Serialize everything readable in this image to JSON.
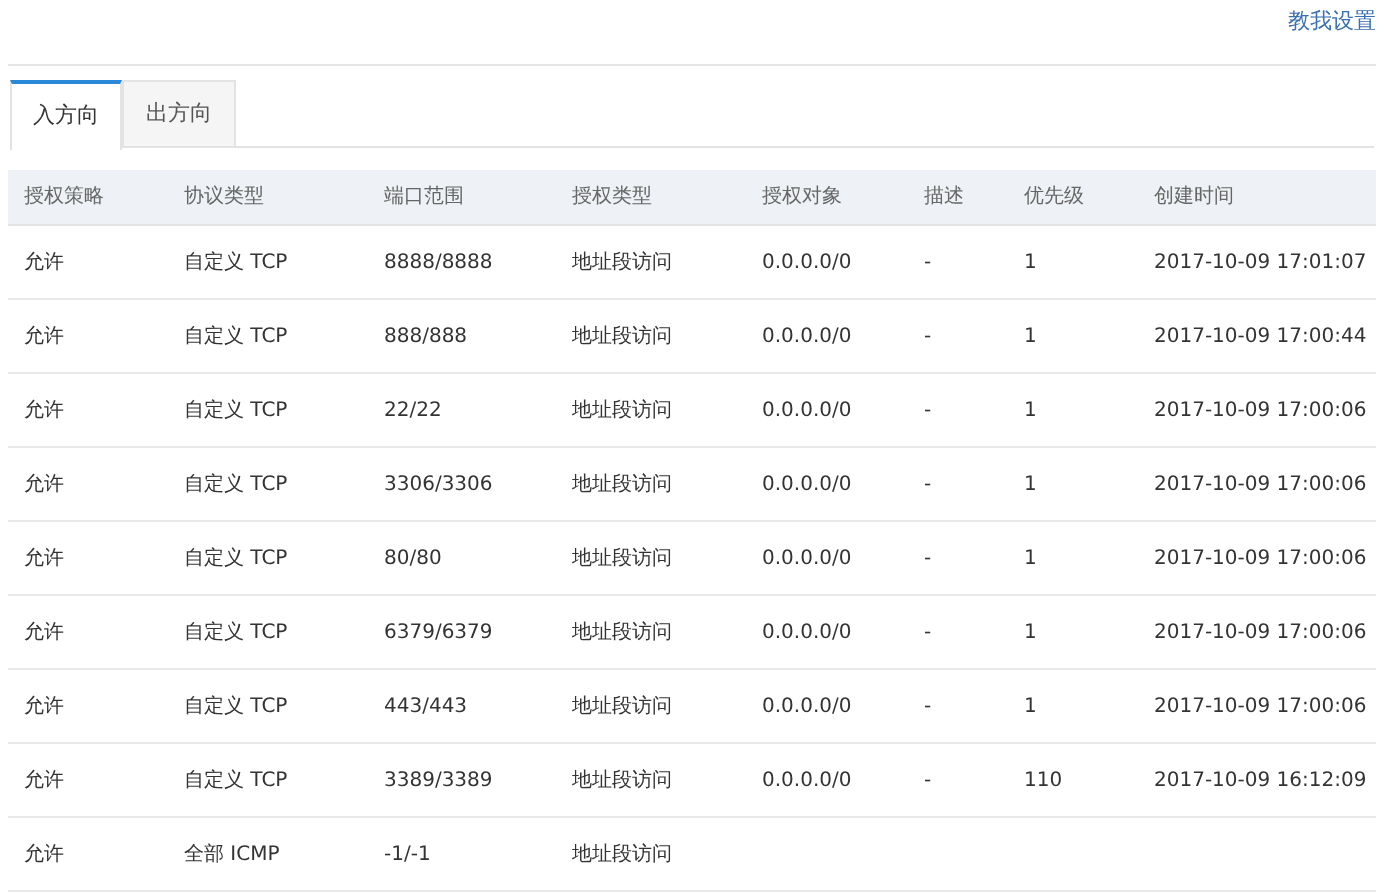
{
  "header": {
    "help_link": "教我设置"
  },
  "tabs": [
    {
      "label": "入方向",
      "selected": true
    },
    {
      "label": "出方向",
      "selected": false
    }
  ],
  "table": {
    "columns": [
      "授权策略",
      "协议类型",
      "端口范围",
      "授权类型",
      "授权对象",
      "描述",
      "优先级",
      "创建时间"
    ],
    "rows": [
      [
        "允许",
        "自定义 TCP",
        "8888/8888",
        "地址段访问",
        "0.0.0.0/0",
        "-",
        "1",
        "2017-10-09 17:01:07"
      ],
      [
        "允许",
        "自定义 TCP",
        "888/888",
        "地址段访问",
        "0.0.0.0/0",
        "-",
        "1",
        "2017-10-09 17:00:44"
      ],
      [
        "允许",
        "自定义 TCP",
        "22/22",
        "地址段访问",
        "0.0.0.0/0",
        "-",
        "1",
        "2017-10-09 17:00:06"
      ],
      [
        "允许",
        "自定义 TCP",
        "3306/3306",
        "地址段访问",
        "0.0.0.0/0",
        "-",
        "1",
        "2017-10-09 17:00:06"
      ],
      [
        "允许",
        "自定义 TCP",
        "80/80",
        "地址段访问",
        "0.0.0.0/0",
        "-",
        "1",
        "2017-10-09 17:00:06"
      ],
      [
        "允许",
        "自定义 TCP",
        "6379/6379",
        "地址段访问",
        "0.0.0.0/0",
        "-",
        "1",
        "2017-10-09 17:00:06"
      ],
      [
        "允许",
        "自定义 TCP",
        "443/443",
        "地址段访问",
        "0.0.0.0/0",
        "-",
        "1",
        "2017-10-09 17:00:06"
      ],
      [
        "允许",
        "自定义 TCP",
        "3389/3389",
        "地址段访问",
        "0.0.0.0/0",
        "-",
        "110",
        "2017-10-09 16:12:09"
      ],
      [
        "允许",
        "全部 ICMP",
        "-1/-1",
        "地址段访问"
      ]
    ]
  }
}
